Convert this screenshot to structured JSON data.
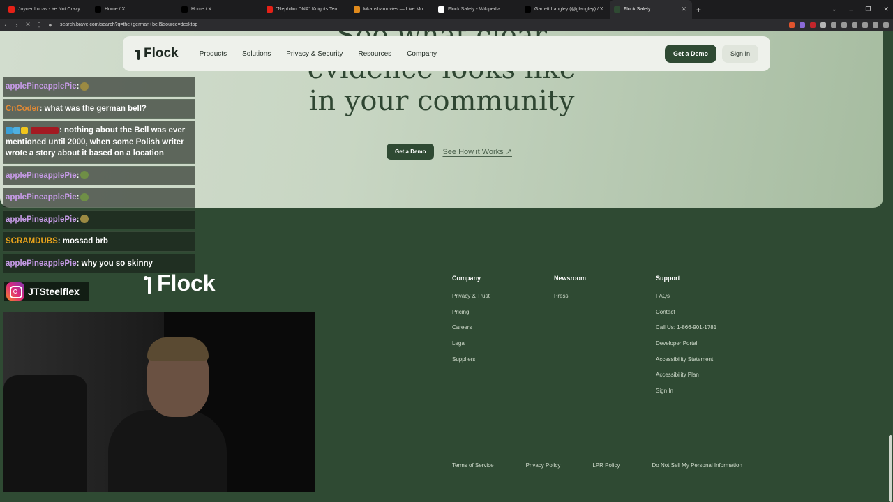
{
  "browser": {
    "tabs": [
      {
        "title": "Joyner Lucas - Ye Not Crazy (Official",
        "favicon": "youtube-icon",
        "color": "#e62117"
      },
      {
        "title": "Home / X",
        "favicon": "x-icon",
        "color": "#000000"
      },
      {
        "title": "Home / X",
        "favicon": "x-icon",
        "color": "#000000"
      },
      {
        "title": "\"Nephilim DNA\" Knights Templar, Re",
        "favicon": "youtube-icon",
        "color": "#e62117"
      },
      {
        "title": "kikanshamovies — Live Movie Chann",
        "favicon": "kick-icon",
        "color": "#e08a1c"
      },
      {
        "title": "Flock Safety - Wikipedia",
        "favicon": "wikipedia-icon",
        "color": "#ffffff"
      },
      {
        "title": "Garrett Langley (@glangley) / X",
        "favicon": "x-icon",
        "color": "#000000"
      },
      {
        "title": "Flock Safety",
        "favicon": "flock-icon",
        "color": "#2f4a33",
        "active": true
      }
    ],
    "url": "search.brave.com/search?q=the+german+bell&source=desktop"
  },
  "page": {
    "nav": {
      "logo": "Flock",
      "menu": [
        "Products",
        "Solutions",
        "Privacy & Security",
        "Resources",
        "Company"
      ],
      "demo": "Get a Demo",
      "signin": "Sign In"
    },
    "hero": {
      "line1": "See what clear",
      "line2": "evidence looks like",
      "line3": "in your community",
      "cta_demo": "Get a Demo",
      "cta_how": "See How it Works ↗"
    },
    "footer": {
      "logo": "Flock",
      "columns": [
        {
          "heading": "Company",
          "links": [
            "Privacy & Trust",
            "Pricing",
            "Careers",
            "Legal",
            "Suppliers"
          ]
        },
        {
          "heading": "Newsroom",
          "links": [
            "Press"
          ]
        },
        {
          "heading": "Support",
          "links": [
            "FAQs",
            "Contact",
            "Call Us: 1-866-901-1781",
            "Developer Portal",
            "Accessibility Statement",
            "Accessibility Plan",
            "Sign In"
          ]
        }
      ],
      "bottom": [
        "Terms of Service",
        "Privacy Policy",
        "LPR Policy",
        "Do Not Sell My Personal Information"
      ]
    }
  },
  "overlay": {
    "chat": [
      {
        "user": "applePineapplePie",
        "color": "#c79be8",
        "text": ":",
        "emote": "emote-bear"
      },
      {
        "user": "CnCoder",
        "color": "#e38a35",
        "text": ": what was the german bell?"
      },
      {
        "user": "",
        "color": "#d21f2a",
        "text": ": nothing about the Bell was ever mentioned until 2000, when some Polish writer wrote a story about it based on a location",
        "badges": true
      },
      {
        "user": "applePineapplePie",
        "color": "#c79be8",
        "text": ":",
        "emote": "emote-green"
      },
      {
        "user": "applePineapplePie",
        "color": "#c79be8",
        "text": ":",
        "emote": "emote-green"
      },
      {
        "user": "applePineapplePie",
        "color": "#c79be8",
        "text": ":",
        "emote": "emote-bear"
      },
      {
        "user": "SCRAMDUBS",
        "color": "#e8a21b",
        "text": ": mossad brb"
      },
      {
        "user": "applePineapplePie",
        "color": "#c79be8",
        "text": ": why you so skinny"
      }
    ],
    "instagram": "JTSteelflex"
  }
}
